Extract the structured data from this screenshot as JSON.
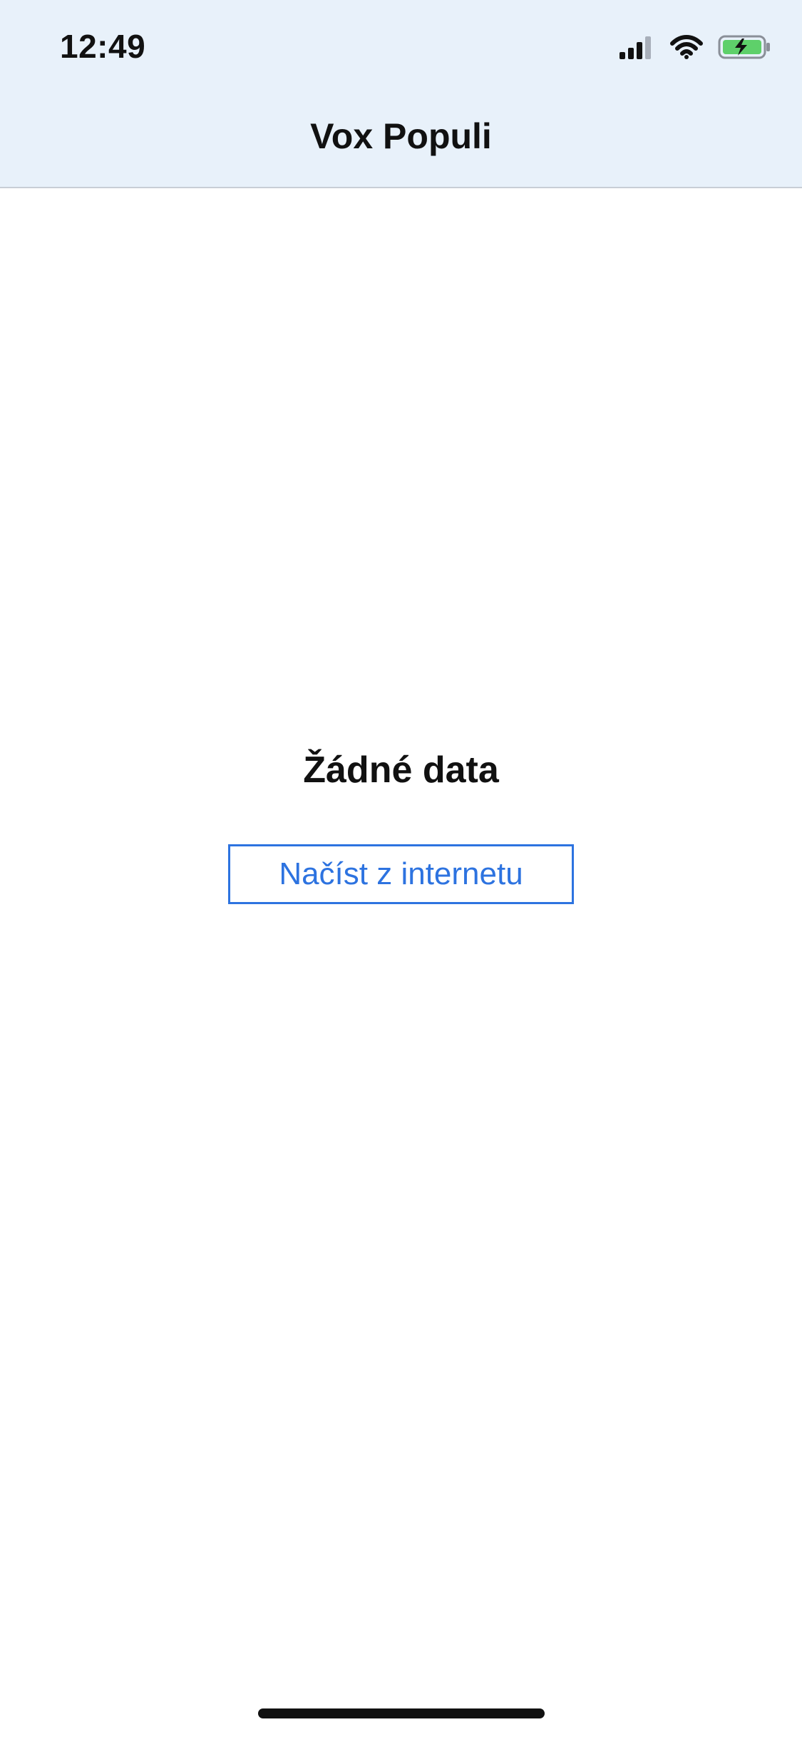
{
  "status_bar": {
    "time": "12:49",
    "icons": [
      "signal-icon",
      "wifi-icon",
      "battery-charging-icon"
    ]
  },
  "navbar": {
    "title": "Vox Populi"
  },
  "empty_state": {
    "title": "Žádné data",
    "button_label": "Načíst z internetu"
  },
  "colors": {
    "header_background": "#E8F1FA",
    "accent": "#2D73E0",
    "battery_fill": "#5ED06A"
  }
}
